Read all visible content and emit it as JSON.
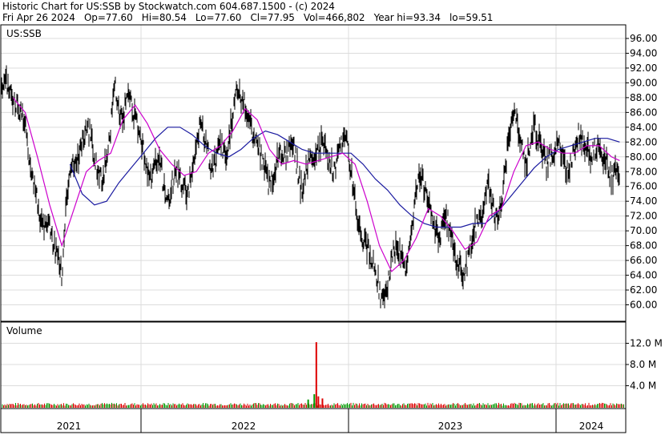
{
  "header": {
    "line1": "Historic Chart for US:SSB by Stockwatch.com 604.687.1500 - (c) 2024",
    "line2": "Fri Apr 26 2024   Op=77.60   Hi=80.54   Lo=77.60   Cl=77.95   Vol=466,802   Year hi=93.34   lo=59.51"
  },
  "price_panel": {
    "symbol_label": "US:SSB"
  },
  "volume_panel": {
    "label": "Volume"
  },
  "chart_data": [
    {
      "type": "line",
      "title": "US:SSB",
      "x_labels": [
        "2021",
        "2022",
        "2023",
        "2024"
      ],
      "y_ticks": [
        "96.00",
        "94.00",
        "92.00",
        "90.00",
        "88.00",
        "86.00",
        "84.00",
        "82.00",
        "80.00",
        "78.00",
        "76.00",
        "74.00",
        "72.00",
        "70.00",
        "68.00",
        "66.00",
        "64.00",
        "62.00",
        "60.00"
      ],
      "ylim": [
        58.5,
        97.5
      ],
      "grid": true,
      "colors": {
        "price": "#000000",
        "ma_short": "#cc00cc",
        "ma_long": "#1a1aa0"
      },
      "series": [
        {
          "role": "price",
          "points": [
            [
              2020.86,
              88.0
            ],
            [
              2020.88,
              90.0
            ],
            [
              2020.9,
              89.5
            ],
            [
              2020.93,
              87.0
            ],
            [
              2020.95,
              86.5
            ],
            [
              2020.98,
              84.0
            ],
            [
              2021.0,
              80.0
            ],
            [
              2021.02,
              77.0
            ],
            [
              2021.04,
              74.0
            ],
            [
              2021.06,
              71.0
            ],
            [
              2021.08,
              70.0
            ],
            [
              2021.1,
              71.0
            ],
            [
              2021.12,
              68.0
            ],
            [
              2021.14,
              67.0
            ],
            [
              2021.16,
              64.0
            ],
            [
              2021.18,
              73.0
            ],
            [
              2021.2,
              79.0
            ],
            [
              2021.22,
              79.0
            ],
            [
              2021.24,
              80.0
            ],
            [
              2021.26,
              82.0
            ],
            [
              2021.28,
              84.0
            ],
            [
              2021.3,
              83.0
            ],
            [
              2021.32,
              80.0
            ],
            [
              2021.34,
              78.0
            ],
            [
              2021.36,
              77.0
            ],
            [
              2021.38,
              80.0
            ],
            [
              2021.4,
              84.0
            ],
            [
              2021.42,
              90.0
            ],
            [
              2021.44,
              86.0
            ],
            [
              2021.46,
              85.0
            ],
            [
              2021.48,
              88.0
            ],
            [
              2021.5,
              87.0
            ],
            [
              2021.52,
              85.0
            ],
            [
              2021.54,
              83.0
            ],
            [
              2021.56,
              81.0
            ],
            [
              2021.58,
              78.0
            ],
            [
              2021.6,
              77.0
            ],
            [
              2021.62,
              79.0
            ],
            [
              2021.64,
              80.0
            ],
            [
              2021.66,
              76.0
            ],
            [
              2021.68,
              74.0
            ],
            [
              2021.7,
              76.0
            ],
            [
              2021.72,
              78.0
            ],
            [
              2021.74,
              77.0
            ],
            [
              2021.76,
              76.0
            ],
            [
              2021.78,
              75.0
            ],
            [
              2021.8,
              78.0
            ],
            [
              2021.82,
              82.0
            ],
            [
              2021.84,
              84.0
            ],
            [
              2021.86,
              83.0
            ],
            [
              2021.88,
              80.0
            ],
            [
              2021.9,
              78.0
            ],
            [
              2021.92,
              80.0
            ],
            [
              2021.94,
              82.0
            ],
            [
              2021.96,
              80.0
            ],
            [
              2021.98,
              82.0
            ],
            [
              2022.0,
              86.0
            ],
            [
              2022.02,
              90.0
            ],
            [
              2022.04,
              88.0
            ],
            [
              2022.06,
              87.0
            ],
            [
              2022.08,
              85.0
            ],
            [
              2022.1,
              83.0
            ],
            [
              2022.12,
              82.0
            ],
            [
              2022.14,
              80.0
            ],
            [
              2022.16,
              78.0
            ],
            [
              2022.18,
              76.0
            ],
            [
              2022.2,
              77.0
            ],
            [
              2022.22,
              80.0
            ],
            [
              2022.24,
              81.0
            ],
            [
              2022.26,
              80.0
            ],
            [
              2022.28,
              82.0
            ],
            [
              2022.3,
              81.0
            ],
            [
              2022.32,
              78.0
            ],
            [
              2022.34,
              75.0
            ],
            [
              2022.36,
              78.0
            ],
            [
              2022.38,
              80.0
            ],
            [
              2022.4,
              79.0
            ],
            [
              2022.42,
              81.0
            ],
            [
              2022.44,
              82.0
            ],
            [
              2022.46,
              80.0
            ],
            [
              2022.48,
              79.0
            ],
            [
              2022.5,
              78.0
            ],
            [
              2022.52,
              80.0
            ],
            [
              2022.54,
              83.0
            ],
            [
              2022.56,
              82.0
            ],
            [
              2022.58,
              78.0
            ],
            [
              2022.6,
              74.0
            ],
            [
              2022.62,
              71.0
            ],
            [
              2022.64,
              69.0
            ],
            [
              2022.66,
              68.0
            ],
            [
              2022.68,
              66.0
            ],
            [
              2022.7,
              65.0
            ],
            [
              2022.72,
              62.0
            ],
            [
              2022.74,
              60.0
            ],
            [
              2022.76,
              63.0
            ],
            [
              2022.78,
              66.0
            ],
            [
              2022.8,
              68.0
            ],
            [
              2022.82,
              67.0
            ],
            [
              2022.84,
              65.0
            ],
            [
              2022.86,
              66.0
            ],
            [
              2022.88,
              70.0
            ],
            [
              2022.9,
              75.0
            ],
            [
              2022.92,
              78.0
            ],
            [
              2022.94,
              76.0
            ],
            [
              2022.96,
              74.0
            ],
            [
              2022.98,
              71.0
            ],
            [
              2023.0,
              70.0
            ],
            [
              2023.02,
              69.0
            ],
            [
              2023.04,
              72.0
            ],
            [
              2023.06,
              71.0
            ],
            [
              2023.08,
              68.0
            ],
            [
              2023.1,
              66.0
            ],
            [
              2023.12,
              65.0
            ],
            [
              2023.14,
              64.0
            ],
            [
              2023.16,
              67.0
            ],
            [
              2023.18,
              70.0
            ],
            [
              2023.2,
              71.0
            ],
            [
              2023.22,
              72.0
            ],
            [
              2023.24,
              75.0
            ],
            [
              2023.26,
              76.0
            ],
            [
              2023.28,
              73.0
            ],
            [
              2023.3,
              71.0
            ],
            [
              2023.32,
              74.0
            ],
            [
              2023.34,
              79.0
            ],
            [
              2023.36,
              84.0
            ],
            [
              2023.38,
              86.0
            ],
            [
              2023.4,
              84.0
            ],
            [
              2023.42,
              81.0
            ],
            [
              2023.44,
              79.0
            ],
            [
              2023.46,
              82.0
            ],
            [
              2023.48,
              84.0
            ],
            [
              2023.5,
              83.0
            ],
            [
              2023.52,
              81.0
            ],
            [
              2023.54,
              79.0
            ],
            [
              2023.56,
              80.0
            ],
            [
              2023.58,
              81.0
            ],
            [
              2023.6,
              82.0
            ],
            [
              2023.62,
              80.0
            ],
            [
              2023.64,
              78.0
            ],
            [
              2023.66,
              79.0
            ],
            [
              2023.68,
              82.0
            ],
            [
              2023.7,
              83.0
            ],
            [
              2023.72,
              82.0
            ],
            [
              2023.74,
              81.0
            ],
            [
              2023.76,
              80.0
            ],
            [
              2023.78,
              81.0
            ],
            [
              2023.8,
              82.0
            ],
            [
              2023.82,
              80.0
            ],
            [
              2023.84,
              79.0
            ],
            [
              2023.86,
              77.0
            ],
            [
              2023.88,
              78.0
            ],
            [
              2023.9,
              77.0
            ]
          ]
        },
        {
          "role": "ma_short",
          "points": [
            [
              2020.92,
              88.0
            ],
            [
              2020.98,
              86.0
            ],
            [
              2021.04,
              80.0
            ],
            [
              2021.1,
              73.5
            ],
            [
              2021.16,
              68.0
            ],
            [
              2021.22,
              73.0
            ],
            [
              2021.28,
              78.0
            ],
            [
              2021.34,
              79.5
            ],
            [
              2021.4,
              80.5
            ],
            [
              2021.46,
              85.0
            ],
            [
              2021.52,
              87.0
            ],
            [
              2021.58,
              84.5
            ],
            [
              2021.64,
              81.0
            ],
            [
              2021.7,
              79.0
            ],
            [
              2021.76,
              77.5
            ],
            [
              2021.82,
              78.0
            ],
            [
              2021.88,
              80.5
            ],
            [
              2021.94,
              81.5
            ],
            [
              2022.0,
              83.5
            ],
            [
              2022.06,
              86.5
            ],
            [
              2022.12,
              85.0
            ],
            [
              2022.18,
              81.0
            ],
            [
              2022.24,
              79.0
            ],
            [
              2022.3,
              79.5
            ],
            [
              2022.36,
              79.0
            ],
            [
              2022.42,
              79.5
            ],
            [
              2022.48,
              80.0
            ],
            [
              2022.54,
              80.5
            ],
            [
              2022.6,
              79.0
            ],
            [
              2022.66,
              74.0
            ],
            [
              2022.72,
              68.0
            ],
            [
              2022.78,
              64.5
            ],
            [
              2022.84,
              66.0
            ],
            [
              2022.9,
              69.0
            ],
            [
              2022.96,
              73.0
            ],
            [
              2023.02,
              72.0
            ],
            [
              2023.08,
              70.0
            ],
            [
              2023.14,
              67.5
            ],
            [
              2023.2,
              68.5
            ],
            [
              2023.26,
              72.0
            ],
            [
              2023.32,
              73.0
            ],
            [
              2023.38,
              78.0
            ],
            [
              2023.44,
              81.5
            ],
            [
              2023.5,
              82.0
            ],
            [
              2023.56,
              81.0
            ],
            [
              2023.62,
              80.5
            ],
            [
              2023.68,
              80.5
            ],
            [
              2023.74,
              81.5
            ],
            [
              2023.8,
              81.5
            ],
            [
              2023.86,
              80.0
            ],
            [
              2023.9,
              79.5
            ]
          ]
        },
        {
          "role": "ma_long",
          "points": [
            [
              2021.2,
              79.0
            ],
            [
              2021.26,
              75.0
            ],
            [
              2021.32,
              73.5
            ],
            [
              2021.38,
              74.0
            ],
            [
              2021.44,
              76.5
            ],
            [
              2021.5,
              78.5
            ],
            [
              2021.56,
              80.5
            ],
            [
              2021.62,
              82.5
            ],
            [
              2021.68,
              84.0
            ],
            [
              2021.74,
              84.0
            ],
            [
              2021.8,
              83.0
            ],
            [
              2021.86,
              81.5
            ],
            [
              2021.92,
              80.5
            ],
            [
              2021.98,
              80.0
            ],
            [
              2022.04,
              81.0
            ],
            [
              2022.1,
              82.5
            ],
            [
              2022.16,
              83.5
            ],
            [
              2022.22,
              83.0
            ],
            [
              2022.28,
              82.0
            ],
            [
              2022.34,
              81.0
            ],
            [
              2022.4,
              80.5
            ],
            [
              2022.46,
              80.5
            ],
            [
              2022.52,
              80.5
            ],
            [
              2022.58,
              80.5
            ],
            [
              2022.64,
              79.0
            ],
            [
              2022.7,
              77.0
            ],
            [
              2022.76,
              75.5
            ],
            [
              2022.82,
              73.5
            ],
            [
              2022.88,
              72.0
            ],
            [
              2022.94,
              71.0
            ],
            [
              2023.0,
              70.5
            ],
            [
              2023.06,
              70.5
            ],
            [
              2023.12,
              70.5
            ],
            [
              2023.18,
              71.0
            ],
            [
              2023.24,
              71.0
            ],
            [
              2023.3,
              72.5
            ],
            [
              2023.36,
              74.5
            ],
            [
              2023.42,
              76.5
            ],
            [
              2023.48,
              78.5
            ],
            [
              2023.54,
              80.0
            ],
            [
              2023.6,
              81.0
            ],
            [
              2023.66,
              81.5
            ],
            [
              2023.72,
              82.0
            ],
            [
              2023.78,
              82.5
            ],
            [
              2023.84,
              82.5
            ],
            [
              2023.9,
              82.0
            ]
          ]
        }
      ]
    },
    {
      "type": "bar",
      "title": "Volume",
      "y_ticks": [
        "12.0 M",
        "8.0 M",
        "4.0 M"
      ],
      "ylim": [
        0,
        14.2
      ],
      "grid": true,
      "colors": {
        "up": "#009900",
        "down": "#dd0000"
      },
      "spikes": [
        {
          "x": 2022.41,
          "value_m": 12.2,
          "color": "down"
        },
        {
          "x": 2022.4,
          "value_m": 2.4,
          "color": "up"
        },
        {
          "x": 2022.42,
          "value_m": 2.0,
          "color": "down"
        },
        {
          "x": 2022.44,
          "value_m": 1.6,
          "color": "down"
        },
        {
          "x": 2022.37,
          "value_m": 1.4,
          "color": "up"
        }
      ],
      "baseline_m": 0.6
    }
  ]
}
